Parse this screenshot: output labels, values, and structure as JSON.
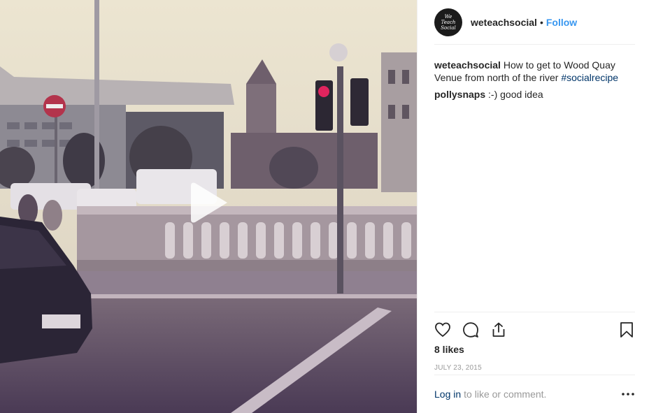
{
  "header": {
    "avatar_text": [
      "We",
      "Teach",
      "Social"
    ],
    "username": "weteachsocial",
    "separator": "•",
    "follow_label": "Follow"
  },
  "comments": [
    {
      "user": "weteachsocial",
      "text": "How to get to Wood Quay Venue from north of the river",
      "hashtag": "#socialrecipe"
    },
    {
      "user": "pollysnaps",
      "text": ":-) good idea"
    }
  ],
  "actions": {
    "icons": [
      "heart-icon",
      "comment-icon",
      "share-icon",
      "bookmark-icon"
    ]
  },
  "likes": "8 likes",
  "date": "JULY 23, 2015",
  "footer": {
    "login_label": "Log in",
    "rest_text": "to like or comment.",
    "more_icon": "more-dots-icon"
  },
  "colors": {
    "link": "#3897f0",
    "hashtag": "#003569",
    "muted": "#999999",
    "traffic_light": "#e0245e"
  }
}
